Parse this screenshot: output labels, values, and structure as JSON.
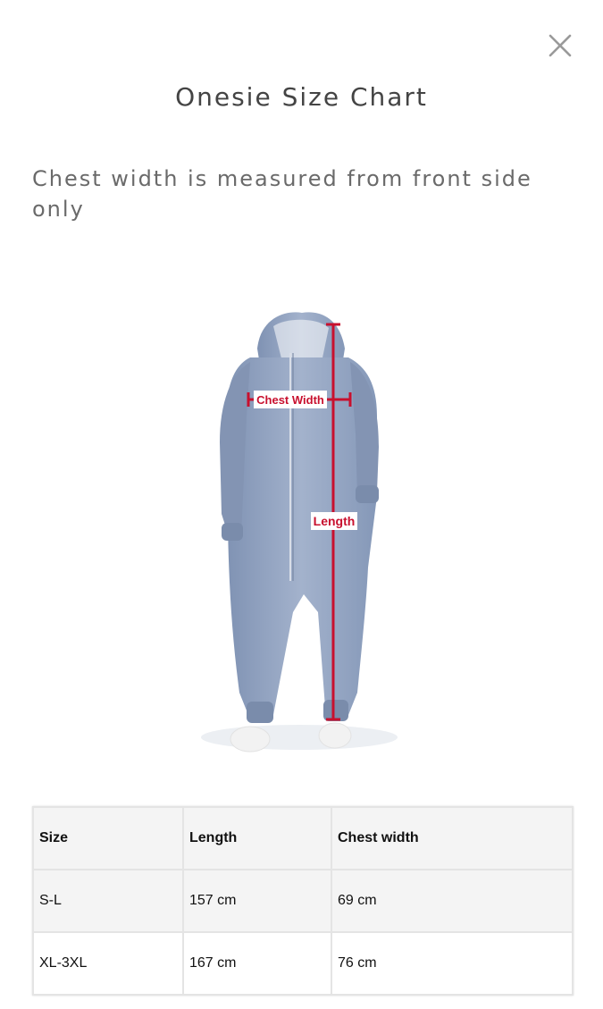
{
  "modal": {
    "title": "Onesie Size Chart",
    "note": "Chest width is measured from front side only",
    "close_icon": "close-icon"
  },
  "figure": {
    "chest_label": "Chest Width",
    "length_label": "Length",
    "garment_color": "#8fa0bd",
    "measure_color": "#c8102e"
  },
  "table": {
    "headers": [
      "Size",
      "Length",
      "Chest width"
    ],
    "rows": [
      [
        "S-L",
        "157 cm",
        "69 cm"
      ],
      [
        "XL-3XL",
        "167 cm",
        "76 cm"
      ]
    ]
  }
}
